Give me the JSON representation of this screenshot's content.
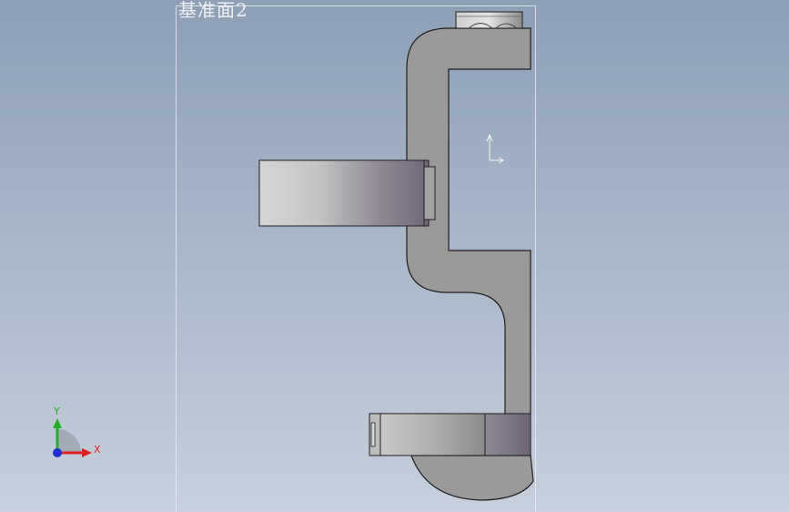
{
  "viewport": {
    "plane_label": "基准面2"
  },
  "triad": {
    "x_label": "X",
    "y_label": "Y"
  },
  "colors": {
    "background_top": "#8e9fb6",
    "background_bottom": "#c7d0dc",
    "part_body": "#9b9b9b",
    "edge": "#202020",
    "x_axis": "#e02020",
    "y_axis": "#22b022",
    "z_axis": "#2030d0"
  }
}
